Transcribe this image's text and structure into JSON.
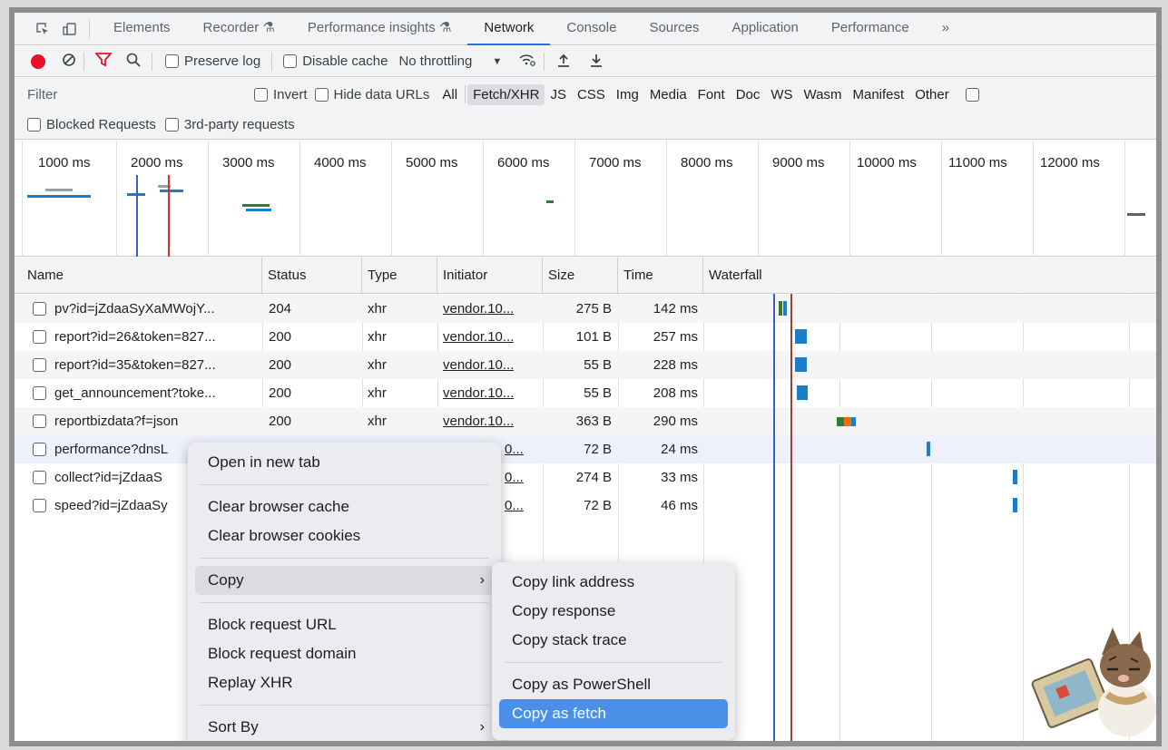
{
  "tabs": [
    "Elements",
    "Recorder",
    "Performance insights",
    "Network",
    "Console",
    "Sources",
    "Application",
    "Performance"
  ],
  "tabs_more": "»",
  "toolbar": {
    "preserve_log": "Preserve log",
    "disable_cache": "Disable cache",
    "throttling": "No throttling"
  },
  "filter": {
    "placeholder": "Filter",
    "invert": "Invert",
    "hide_data_urls": "Hide data URLs",
    "types": [
      "All",
      "Fetch/XHR",
      "JS",
      "CSS",
      "Img",
      "Media",
      "Font",
      "Doc",
      "WS",
      "Wasm",
      "Manifest",
      "Other"
    ],
    "blocked_requests": "Blocked Requests",
    "third_party": "3rd-party requests"
  },
  "overview": {
    "ticks": [
      "1000 ms",
      "2000 ms",
      "3000 ms",
      "4000 ms",
      "5000 ms",
      "6000 ms",
      "7000 ms",
      "8000 ms",
      "9000 ms",
      "10000 ms",
      "11000 ms",
      "12000 ms"
    ]
  },
  "table": {
    "columns": [
      "Name",
      "Status",
      "Type",
      "Initiator",
      "Size",
      "Time",
      "Waterfall"
    ],
    "rows": [
      {
        "name": "pv?id=jZdaaSyXaMWojY...",
        "status": "204",
        "type": "xhr",
        "initiator": "vendor.10...",
        "size": "275 B",
        "time": "142 ms"
      },
      {
        "name": "report?id=26&token=827...",
        "status": "200",
        "type": "xhr",
        "initiator": "vendor.10...",
        "size": "101 B",
        "time": "257 ms"
      },
      {
        "name": "report?id=35&token=827...",
        "status": "200",
        "type": "xhr",
        "initiator": "vendor.10...",
        "size": "55 B",
        "time": "228 ms"
      },
      {
        "name": "get_announcement?toke...",
        "status": "200",
        "type": "xhr",
        "initiator": "vendor.10...",
        "size": "55 B",
        "time": "208 ms"
      },
      {
        "name": "reportbizdata?f=json",
        "status": "200",
        "type": "xhr",
        "initiator": "vendor.10...",
        "size": "363 B",
        "time": "290 ms"
      },
      {
        "name": "performance?dnsL",
        "status": "",
        "type": "",
        "initiator": "0...",
        "size": "72 B",
        "time": "24 ms"
      },
      {
        "name": "collect?id=jZdaaS",
        "status": "",
        "type": "",
        "initiator": "0...",
        "size": "274 B",
        "time": "33 ms"
      },
      {
        "name": "speed?id=jZdaaSy",
        "status": "",
        "type": "",
        "initiator": "0...",
        "size": "72 B",
        "time": "46 ms"
      }
    ]
  },
  "context_menu": {
    "items": [
      "Open in new tab",
      "Clear browser cache",
      "Clear browser cookies",
      "Copy",
      "Block request URL",
      "Block request domain",
      "Replay XHR",
      "Sort By"
    ]
  },
  "copy_submenu": {
    "items": [
      "Copy link address",
      "Copy response",
      "Copy stack trace",
      "Copy as PowerShell",
      "Copy as fetch"
    ],
    "selected": "Copy as fetch"
  },
  "colors": {
    "record": "#e8102a",
    "accent": "#1a73e8",
    "menu_selected": "#4a90e8",
    "waterfall_bar": "#1a7fc8"
  }
}
